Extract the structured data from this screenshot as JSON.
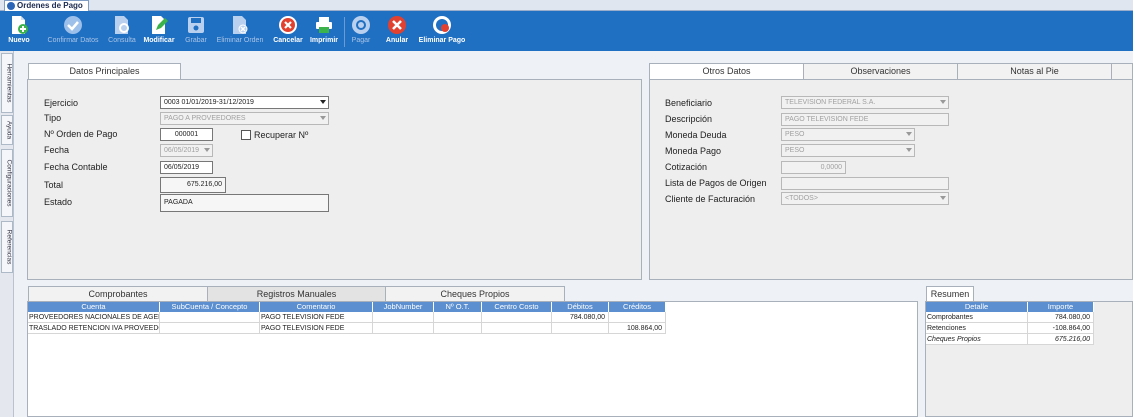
{
  "window": {
    "tab_title": "Ordenes de Pago"
  },
  "toolbar": {
    "nuevo": "Nuevo",
    "confirmar": "Confirmar Datos",
    "consulta": "Consulta",
    "modificar": "Modificar",
    "grabar": "Grabar",
    "eliminar_orden": "Eliminar Orden",
    "cancelar": "Cancelar",
    "imprimir": "Imprimir",
    "pagar": "Pagar",
    "anular": "Anular",
    "eliminar_pago": "Eliminar Pago"
  },
  "sidebar": {
    "herramientas": "Herramientas",
    "ayuda": "Ayuda",
    "configuraciones": "Configuraciones",
    "referencias": "Referencias"
  },
  "datos_principales": {
    "tab": "Datos Principales",
    "ejercicio_label": "Ejercicio",
    "ejercicio": "0003 01/01/2019-31/12/2019",
    "tipo_label": "Tipo",
    "tipo": "PAGO A PROVEEDORES",
    "orden_label": "Nº Orden de Pago",
    "orden": "000001",
    "recuperar_label": "Recuperar Nº",
    "fecha_label": "Fecha",
    "fecha": "06/05/2019",
    "fecha_contable_label": "Fecha Contable",
    "fecha_contable": "06/05/2019",
    "total_label": "Total",
    "total": "675.216,00",
    "estado_label": "Estado",
    "estado": "PAGADA"
  },
  "otros": {
    "tabs": [
      "Otros Datos",
      "Observaciones",
      "Notas al Pie"
    ],
    "beneficiario_label": "Beneficiario",
    "beneficiario": "TELEVISION FEDERAL S.A.",
    "descripcion_label": "Descripción",
    "descripcion": "PAGO TELEVISION FEDE",
    "moneda_deuda_label": "Moneda Deuda",
    "moneda_deuda": "PESO",
    "moneda_pago_label": "Moneda Pago",
    "moneda_pago": "PESO",
    "cotizacion_label": "Cotización",
    "cotizacion": "0,0000",
    "lista_label": "Lista de Pagos de Origen",
    "lista": "",
    "cliente_label": "Cliente de Facturación",
    "cliente": "<TODOS>"
  },
  "registros": {
    "tabs": [
      "Comprobantes",
      "Registros Manuales",
      "Cheques Propios"
    ],
    "headers": [
      "Cuenta",
      "SubCuenta / Concepto",
      "Comentario",
      "JobNumber",
      "Nº O.T.",
      "Centro Costo",
      "Débitos",
      "Créditos"
    ],
    "rows": [
      [
        "PROVEEDORES NACIONALES DE AGENCIA",
        "",
        "PAGO TELEVISION FEDE",
        "",
        "",
        "",
        "784.080,00",
        ""
      ],
      [
        "TRASLADO RETENCION IVA PROVEEDORES",
        "",
        "PAGO TELEVISION FEDE",
        "",
        "",
        "",
        "",
        "108.864,00"
      ]
    ]
  },
  "resumen": {
    "tab": "Resumen",
    "headers": [
      "Detalle",
      "Importe"
    ],
    "rows": [
      [
        "Comprobantes",
        "784.080,00"
      ],
      [
        "Retenciones",
        "-108.864,00"
      ],
      [
        "Cheques Propios",
        "675.216,00"
      ]
    ]
  }
}
